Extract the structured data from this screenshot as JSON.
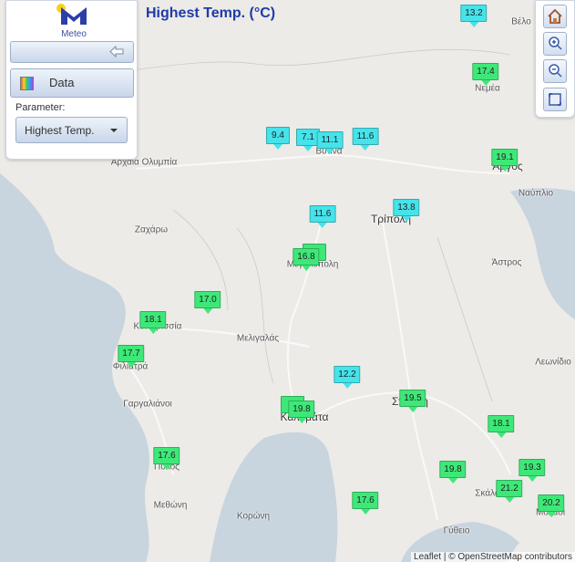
{
  "title": "Highest Temp. (°C)",
  "logo": {
    "text": "Meteo"
  },
  "panel": {
    "data_label": "Data",
    "parameter_label": "Parameter:",
    "parameter_value": "Highest Temp."
  },
  "colors": {
    "cold": "#45e3ea",
    "warm": "#3ee878",
    "title": "#1f3aa8"
  },
  "icons": {
    "collapse": "arrow-left-icon",
    "data": "palette-icon",
    "home": "home-icon",
    "zoom_in": "zoom-in-icon",
    "zoom_out": "zoom-out-icon",
    "extent": "full-extent-icon"
  },
  "places": [
    {
      "name": "Βέλο",
      "big": false
    },
    {
      "name": "Νεμέα",
      "big": false
    },
    {
      "name": "Άργος",
      "big": true
    },
    {
      "name": "Ναύπλιο",
      "big": false
    },
    {
      "name": "Αρχαία Ολυμπία",
      "big": false
    },
    {
      "name": "Βυτίνα",
      "big": false
    },
    {
      "name": "Ζαχάρω",
      "big": false
    },
    {
      "name": "Τρίπολη",
      "big": true
    },
    {
      "name": "Μεγαλόπολη",
      "big": false
    },
    {
      "name": "Άστρος",
      "big": false
    },
    {
      "name": "Κυπαρισσία",
      "big": false
    },
    {
      "name": "Μελιγαλάς",
      "big": false
    },
    {
      "name": "Φιλιατρά",
      "big": false
    },
    {
      "name": "Λεωνίδιο",
      "big": false
    },
    {
      "name": "Γαργαλιάνοι",
      "big": false
    },
    {
      "name": "Σπάρτη",
      "big": true
    },
    {
      "name": "Καλαμάτα",
      "big": true
    },
    {
      "name": "Πύλος",
      "big": false
    },
    {
      "name": "Σκάλα",
      "big": false
    },
    {
      "name": "Μεθώνη",
      "big": false
    },
    {
      "name": "Κορώνη",
      "big": false
    },
    {
      "name": "Γύθειο",
      "big": false
    },
    {
      "name": "Μολάοι",
      "big": false
    }
  ],
  "stations": [
    {
      "value": "13.2",
      "band": "cold"
    },
    {
      "value": "17.4",
      "band": "warm"
    },
    {
      "value": "9.4",
      "band": "cold"
    },
    {
      "value": "7.1",
      "band": "cold"
    },
    {
      "value": "11.1",
      "band": "cold"
    },
    {
      "value": "11.6",
      "band": "cold"
    },
    {
      "value": "19.1",
      "band": "warm"
    },
    {
      "value": "11.6",
      "band": "cold"
    },
    {
      "value": "13.8",
      "band": "cold"
    },
    {
      "value": "4",
      "band": "warm"
    },
    {
      "value": "16.8",
      "band": "warm"
    },
    {
      "value": "17.0",
      "band": "warm"
    },
    {
      "value": "18.1",
      "band": "warm"
    },
    {
      "value": "17.7",
      "band": "warm"
    },
    {
      "value": "12.2",
      "band": "cold"
    },
    {
      "value": "1",
      "band": "warm"
    },
    {
      "value": "19.8",
      "band": "warm"
    },
    {
      "value": "19.5",
      "band": "warm"
    },
    {
      "value": "18.1",
      "band": "warm"
    },
    {
      "value": "17.6",
      "band": "warm"
    },
    {
      "value": "19.8",
      "band": "warm"
    },
    {
      "value": "19.3",
      "band": "warm"
    },
    {
      "value": "21.2",
      "band": "warm"
    },
    {
      "value": "17.6",
      "band": "warm"
    },
    {
      "value": "20.2",
      "band": "warm"
    }
  ],
  "attribution": "Leaflet | © OpenStreetMap contributors"
}
